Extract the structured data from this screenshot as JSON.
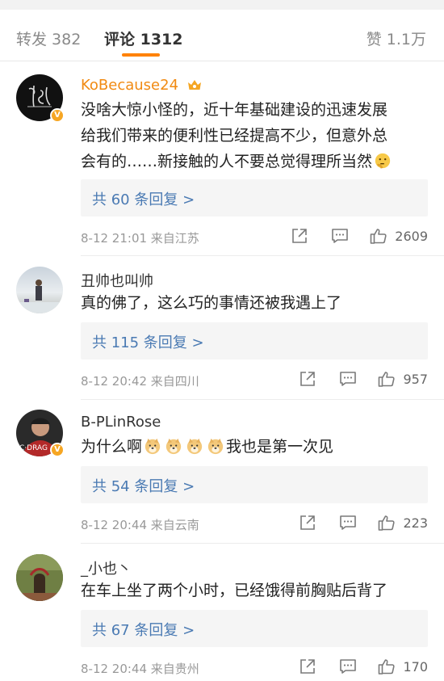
{
  "tabs": {
    "repost": "转发 382",
    "comments": "评论 1312",
    "likes": "赞 1.1万"
  },
  "comments": [
    {
      "username": "KoBecause24",
      "line1": "没啥大惊小怪的，近十年基础建设的迅速发展",
      "line2": "给我们带来的便利性已经提高不少，但意外总",
      "line3": "会有的……新接触的人不要总觉得理所当然",
      "replies": "共 60 条回复 >",
      "meta": "8-12 21:01  来自江苏",
      "likes": "2609"
    },
    {
      "username": "丑帅也叫帅",
      "line1": "真的佛了，这么巧的事情还被我遇上了",
      "replies": "共 115 条回复 >",
      "meta": "8-12 20:42  来自四川",
      "likes": "957"
    },
    {
      "username": "B-PLinRose",
      "line1": "我也是第一次见",
      "prefix": "为什么啊",
      "replies": "共 54 条回复 >",
      "meta": "8-12 20:44  来自云南",
      "likes": "223"
    },
    {
      "username": "_小也丶",
      "line1": "在车上坐了两个小时，已经饿得前胸贴后背了",
      "replies": "共 67 条回复 >",
      "meta": "8-12 20:44  来自贵州",
      "likes": "170"
    }
  ],
  "icons": [
    "verified-badge-icon",
    "vip-crown-icon",
    "share-icon",
    "comment-icon",
    "like-icon",
    "thinking-emoji",
    "doge-emoji"
  ],
  "colors": {
    "accent": "#ff8200",
    "link": "#4a7ab3",
    "vip_name": "#f18a12"
  }
}
